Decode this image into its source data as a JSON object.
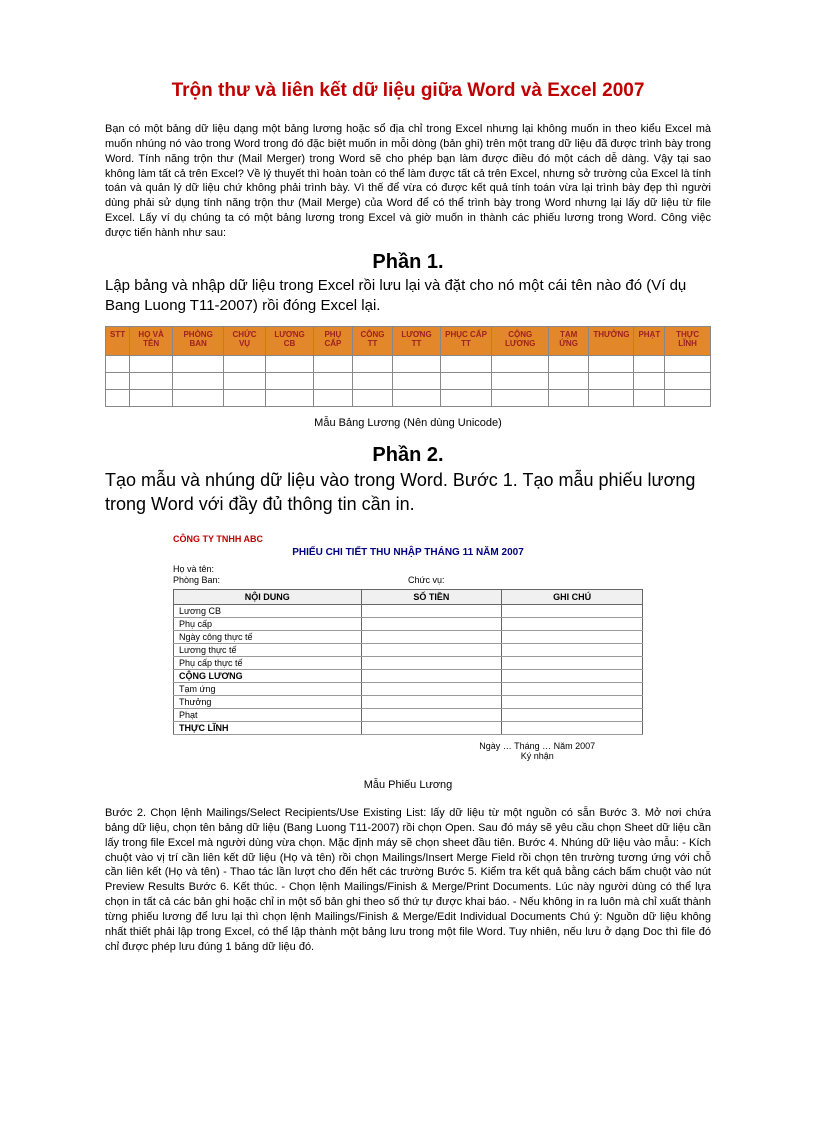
{
  "title": "Trộn thư và liên kết dữ liệu giữa Word và Excel 2007",
  "intro": "Bạn có một bảng dữ liệu dạng một bảng lương hoặc sổ địa chỉ trong Excel nhưng lại không muốn in theo kiểu Excel mà muốn nhúng nó vào trong Word trong đó đặc biệt muốn in mỗi dòng (bản ghi) trên một trang dữ liệu đã được trình bày trong Word. Tính năng trộn thư (Mail Merger) trong Word sẽ cho phép bạn làm được điều đó một cách dễ dàng. Vậy tại sao không làm tất cả trên Excel? Về lý thuyết thì hoàn toàn có thể làm được tất cả trên Excel, nhưng sở trường của Excel là tính toán và quản lý dữ liệu chứ không phải trình bày. Vì thế để vừa có được kết quả tính toán vừa lại trình bày đẹp thì người dùng phải sử dụng tính năng trộn thư (Mail Merge) của Word để có thể trình bày trong Word nhưng lại lấy dữ liệu từ file Excel. Lấy ví dụ chúng ta có một bảng lương trong Excel và giờ muốn in thành các phiếu lương trong Word. Công việc được tiến hành như sau:",
  "section1": {
    "header": "Phần 1.",
    "desc": "Lập bảng và nhập dữ liệu trong Excel rồi lưu lại và đặt cho nó một cái tên nào đó (Ví dụ Bang Luong T11-2007) rồi đóng Excel lại.",
    "caption": "Mẫu Bảng Lương (Nên dùng Unicode)",
    "columns": [
      "STT",
      "HỌ VÀ TÊN",
      "PHÒNG BAN",
      "CHỨC VỤ",
      "LƯƠNG CB",
      "PHỤ CẤP",
      "CÔNG TT",
      "LƯƠNG TT",
      "PHỤC CẤP TT",
      "CỘNG LƯƠNG",
      "TẠM ỨNG",
      "THƯỞNG",
      "PHẠT",
      "THỰC LĨNH"
    ]
  },
  "section2": {
    "header": "Phần 2.",
    "desc": "Tạo mẫu và nhúng dữ liệu vào trong Word. Bước 1. Tạo mẫu phiếu lương trong Word với đầy đủ thông tin cần in.",
    "caption": "Mẫu Phiếu Lương",
    "company": "CÔNG TY TNHH ABC",
    "slipTitle": "PHIẾU CHI TIẾT THU NHẬP THÁNG 11 NĂM 2007",
    "labels": {
      "hoten": "Họ và tên:",
      "phongban": "Phòng Ban:",
      "chucvu": "Chức vụ:"
    },
    "slipHeaders": [
      "NỘI DUNG",
      "SỐ TIỀN",
      "GHI CHÚ"
    ],
    "slipRows": [
      {
        "label": "Lương CB",
        "bold": false
      },
      {
        "label": "Phụ cấp",
        "bold": false
      },
      {
        "label": "Ngày công thực tế",
        "bold": false
      },
      {
        "label": "Lương thực tế",
        "bold": false
      },
      {
        "label": "Phụ cấp thực tế",
        "bold": false
      },
      {
        "label": "CỘNG LƯƠNG",
        "bold": true
      },
      {
        "label": "Tạm ứng",
        "bold": false
      },
      {
        "label": "Thưởng",
        "bold": false
      },
      {
        "label": "Phạt",
        "bold": false
      },
      {
        "label": "THỰC LĨNH",
        "bold": true
      }
    ],
    "sign": "Ngày … Tháng … Năm 2007",
    "signer": "Ký nhận"
  },
  "steps": "Bước 2. Chọn lệnh Mailings/Select Recipients/Use Existing List: lấy dữ liệu từ một nguồn có sẵn Bước 3. Mở nơi chứa bảng dữ liệu, chọn tên bảng dữ liệu (Bang Luong T11-2007) rồi chọn Open. Sau đó máy sẽ yêu cầu chọn Sheet dữ liệu cần lấy trong file Excel mà người dùng vừa chọn. Mặc định máy sẽ chọn sheet đầu tiên. Bước 4. Nhúng dữ liệu vào mẫu: - Kích chuột vào vị trí cần liên kết dữ liệu (Họ và tên) rồi chọn Mailings/Insert Merge Field rồi chọn tên trường tương ứng với chỗ cần liên kết (Họ và tên) - Thao tác lần lượt cho đến hết các trường Bước 5. Kiểm tra kết quả bằng cách bấm chuột vào nút Preview Results Bước 6. Kết thúc. - Chọn lệnh Mailings/Finish & Merge/Print Documents. Lúc này người dùng có thể lựa chọn in tất cả các bản ghi hoặc chỉ in một số bản ghi theo số thứ tự được khai báo. - Nếu không in ra luôn mà chỉ xuất thành từng phiếu lương để lưu lại thì chọn lệnh Mailings/Finish & Merge/Edit Individual Documents Chú ý: Nguồn dữ liệu không nhất thiết phải lập trong Excel, có thể lập thành một bảng lưu trong một file Word. Tuy nhiên, nếu lưu ở dạng Doc thì file đó chỉ được phép lưu đúng 1 bảng dữ liệu đó."
}
